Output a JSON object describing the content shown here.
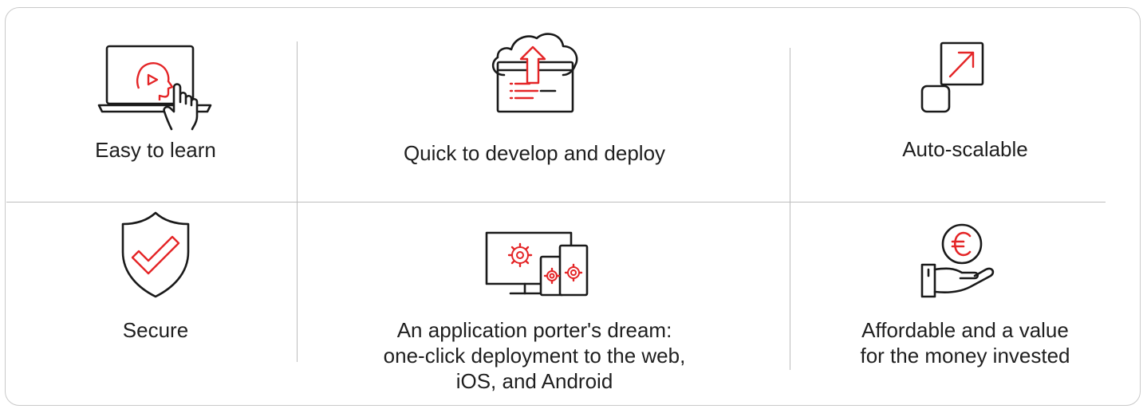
{
  "features": [
    {
      "icon": "video-tutorial-icon",
      "label": "Easy to learn"
    },
    {
      "icon": "cloud-deploy-icon",
      "label": "Quick to develop and deploy"
    },
    {
      "icon": "auto-scale-icon",
      "label": "Auto-scalable"
    },
    {
      "icon": "shield-check-icon",
      "label": "Secure"
    },
    {
      "icon": "multi-device-icon",
      "label_lines": [
        "An application porter's dream:",
        "one-click deployment to the web,",
        "iOS, and Android"
      ]
    },
    {
      "icon": "hand-euro-icon",
      "label_lines": [
        "Affordable and a value",
        "for the money invested"
      ]
    }
  ],
  "colors": {
    "icon_stroke": "#1a1a1a",
    "accent": "#e42527",
    "divider": "#bdbdbd"
  }
}
